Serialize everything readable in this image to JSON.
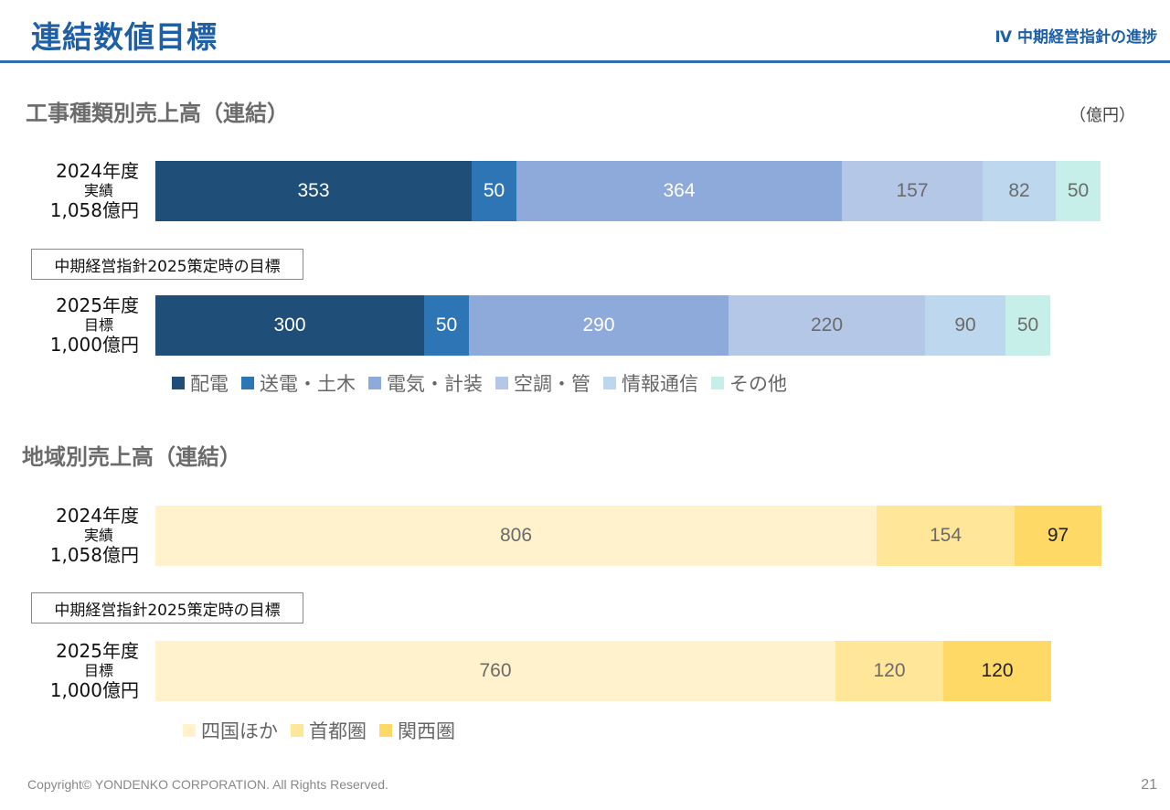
{
  "header": {
    "title": "連結数値目標",
    "section": "Ⅳ  中期経営指針の進捗"
  },
  "unit": "（億円）",
  "plan_box_label": "中期経営指針2025策定時の目標",
  "footer": {
    "copyright": "Copyright© YONDENKO CORPORATION. All Rights Reserved.",
    "page": "21"
  },
  "rows": {
    "actual": {
      "l1": "2024年度",
      "l2": "実績",
      "l3": "1,058億円"
    },
    "target": {
      "l1": "2025年度",
      "l2": "目標",
      "l3": "1,000億円"
    }
  },
  "chart_data": [
    {
      "type": "bar",
      "orientation": "horizontal-stacked",
      "title": "工事種類別売上高（連結）",
      "categories": [
        "2024年度 実績 1,058億円",
        "2025年度 目標 1,000億円"
      ],
      "series": [
        {
          "name": "配電",
          "values": [
            353,
            300
          ],
          "color": "#1f4e79",
          "text_color": "#ffffff"
        },
        {
          "name": "送電・土木",
          "values": [
            50,
            50
          ],
          "color": "#2e75b6",
          "text_color": "#ffffff"
        },
        {
          "name": "電気・計装",
          "values": [
            364,
            290
          ],
          "color": "#8eaadb",
          "text_color": "#ffffff"
        },
        {
          "name": "空調・管",
          "values": [
            157,
            220
          ],
          "color": "#b4c7e7",
          "text_color": "#6b6b6b"
        },
        {
          "name": "情報通信",
          "values": [
            82,
            90
          ],
          "color": "#bdd7ee",
          "text_color": "#6b6b6b"
        },
        {
          "name": "その他",
          "values": [
            50,
            50
          ],
          "color": "#c5efe8",
          "text_color": "#6b6b6b"
        }
      ]
    },
    {
      "type": "bar",
      "orientation": "horizontal-stacked",
      "title": "地域別売上高（連結）",
      "categories": [
        "2024年度 実績 1,058億円",
        "2025年度 目標 1,000億円"
      ],
      "series": [
        {
          "name": "四国ほか",
          "values": [
            806,
            760
          ],
          "color": "#fff2cc",
          "text_color": "#6b6b6b"
        },
        {
          "name": "首都圏",
          "values": [
            154,
            120
          ],
          "color": "#ffe699",
          "text_color": "#6b6b6b"
        },
        {
          "name": "関西圏",
          "values": [
            97,
            120
          ],
          "color": "#ffd966",
          "text_color": "#222222"
        }
      ]
    }
  ]
}
